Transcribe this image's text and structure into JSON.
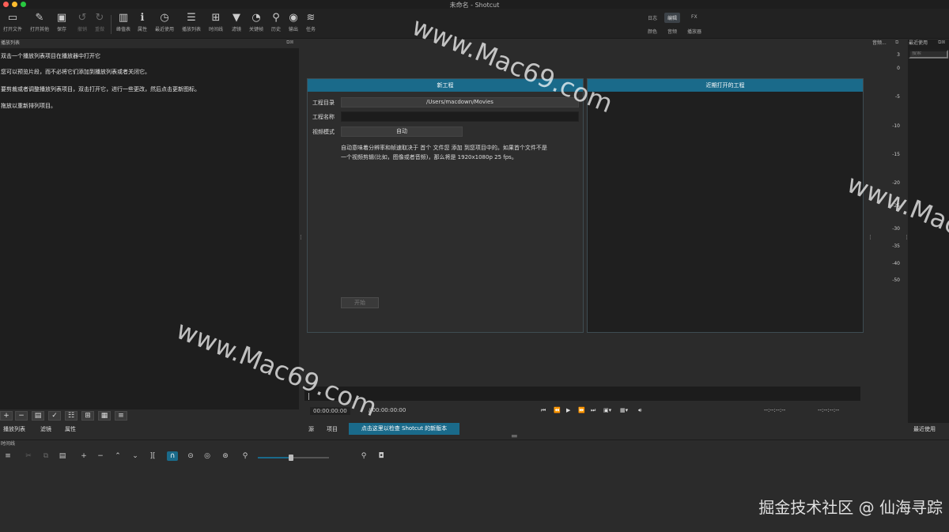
{
  "window": {
    "title": "未命名 - Shotcut"
  },
  "toolbar": {
    "open_file": "打开文件",
    "open_other": "打开其他",
    "save": "保存",
    "undo": "撤销",
    "redo": "重做",
    "peak_meter": "峰值表",
    "properties": "属性",
    "recent": "最近使用",
    "playlist": "播放列表",
    "timeline": "时间线",
    "filters": "滤镜",
    "keyframes": "关键帧",
    "history": "历史",
    "export": "输出",
    "jobs": "任务"
  },
  "layouts": {
    "logging": "日志",
    "editing": "编辑",
    "fx": "FX",
    "color": "颜色",
    "audio": "音频",
    "player": "播放器"
  },
  "playlist": {
    "title": "播放列表",
    "hints": [
      "双击一个播放列表项目在播放器中打开它",
      "您可以预览片段，而不必将它们添加到播放列表或者关闭它。",
      "要剪裁或者调整播放列表项目，双击打开它，进行一些更改，然后点击更新图标。",
      "拖放以重新排列项目。"
    ],
    "buttons": {
      "add": "+",
      "remove": "−"
    },
    "tabs": [
      "播放列表",
      "滤镜",
      "属性"
    ]
  },
  "new_project": {
    "header": "新工程",
    "dir_label": "工程目录",
    "dir_value": "/Users/macdown/Movies",
    "name_label": "工程名称",
    "name_value": "",
    "mode_label": "视频模式",
    "mode_value": "自动",
    "description_line1": "自动意味着分辨率和帧速取决于 首个 文件您 添加 到您项目中的。如果首个文件不是",
    "description_line2": "一个视频剪辑(比如，图像或者音频)，那么将是 1920x1080p 25 fps。",
    "start": "开始"
  },
  "recent_projects": {
    "header": "近期打开的工程"
  },
  "audio_meter": {
    "title": "音频...",
    "ticks": [
      "3",
      "0",
      "-5",
      "-10",
      "-15",
      "-20",
      "-25",
      "-30",
      "-35",
      "-40",
      "-50"
    ]
  },
  "recent_panel": {
    "title": "最近使用",
    "search_placeholder": "搜索",
    "tab": "最近使用"
  },
  "transport": {
    "position": "00:00:00:00",
    "duration": "/ 00:00:00:00",
    "in_point": "--:--:--:--",
    "out_point": "--:--:--:--"
  },
  "bottom_tabs": {
    "source": "源",
    "project": "项目",
    "update": "点击这里以检查 Shotcut 的新版本"
  },
  "timeline": {
    "title": "时间线",
    "zoom_level": 0.47
  },
  "watermarks": {
    "text": "www.Mac69.com",
    "footer": "掘金技术社区 @ 仙海寻踪"
  },
  "colors": {
    "accent": "#1a6a8a",
    "panel_dark": "#1e1e1e",
    "background": "#2b2b2b"
  }
}
